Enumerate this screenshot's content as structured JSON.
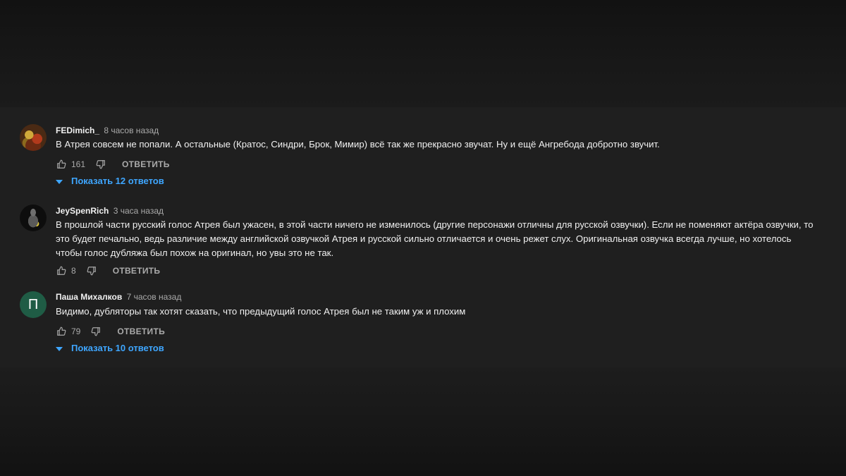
{
  "comments": [
    {
      "author": "FEDimich_",
      "time": "8 часов назад",
      "text": "В Атрея совсем не попали. А остальные (Кратос, Синдри, Брок, Мимир) всё так же прекрасно звучат. Ну и ещё Ангребода добротно звучит.",
      "likes": "161",
      "reply_label": "ОТВЕТИТЬ",
      "show_replies": "Показать 12 ответов",
      "avatar": "photo"
    },
    {
      "author": "JeySpenRich",
      "time": "3 часа назад",
      "text": "В прошлой части русский голос Атрея был ужасен, в этой части ничего не изменилось (другие персонажи отличны для русской озвучки). Если не поменяют актёра озвучки, то это будет печально, ведь различие между английской озвучкой Атрея и русской сильно отличается и очень режет слух. Оригинальная озвучка всегда лучше, но хотелось чтобы голос дубляжа был похож на оригинал, но увы это не так.",
      "likes": "8",
      "reply_label": "ОТВЕТИТЬ",
      "avatar": "photo"
    },
    {
      "author": "Паша Михалков",
      "time": "7 часов назад",
      "text": "Видимо, дубляторы так хотят сказать, что предыдущий голос Атрея был не таким уж и плохим",
      "likes": "79",
      "reply_label": "ОТВЕТИТЬ",
      "show_replies": "Показать 10 ответов",
      "avatar_letter": "П",
      "avatar_color": "#1f5c45"
    }
  ],
  "colors": {
    "link": "#3ea6ff",
    "text": "#f1f1f1",
    "muted": "#aaaaaa",
    "panel": "#1f1f1f"
  },
  "icons": [
    "thumb-up-icon",
    "thumb-down-icon",
    "caret-down-icon"
  ]
}
